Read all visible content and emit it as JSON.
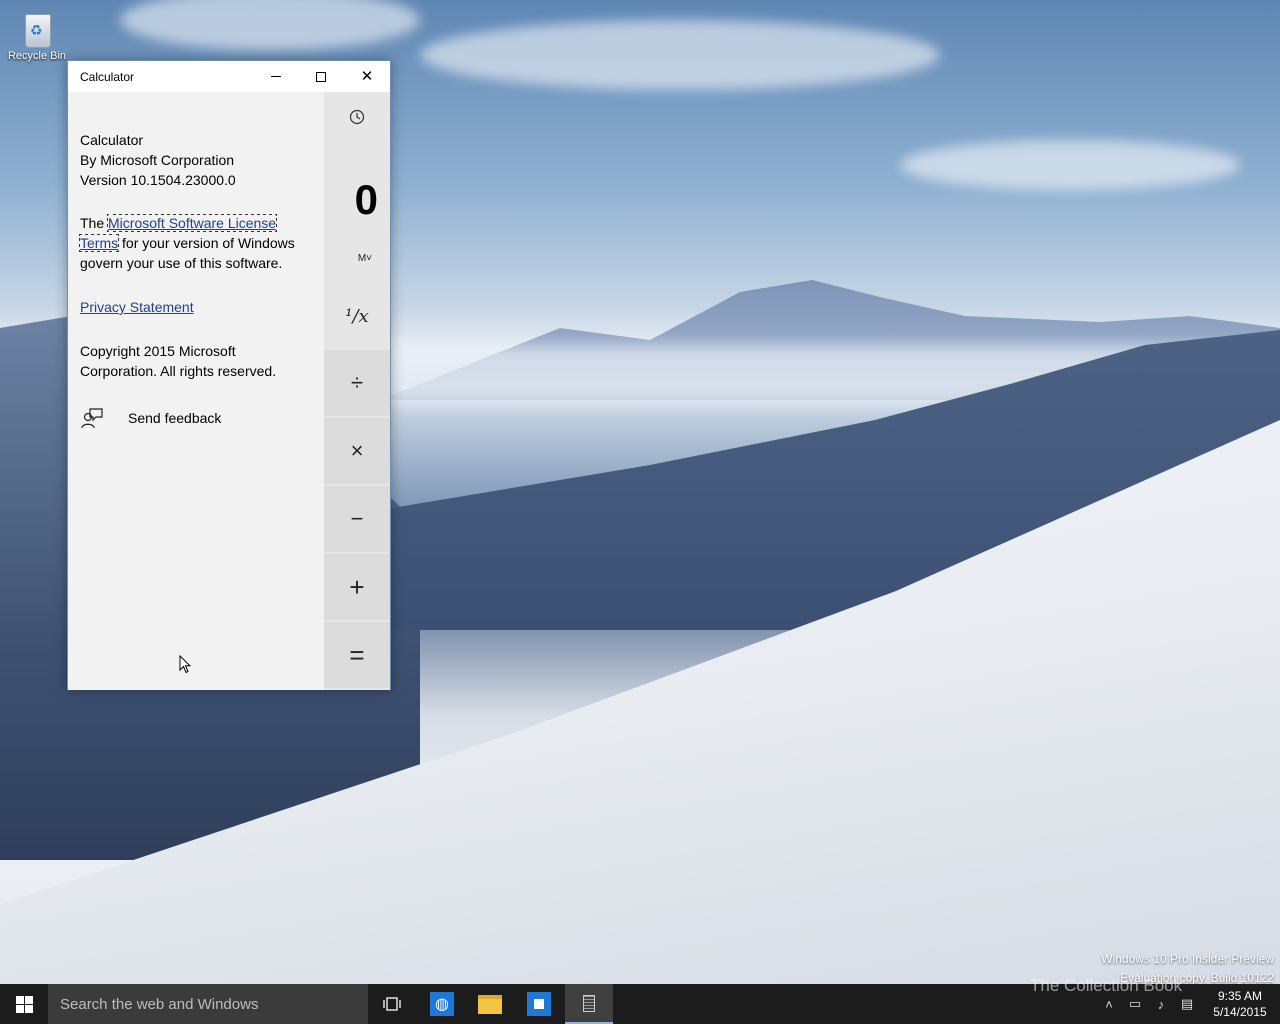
{
  "desktop": {
    "recycle_bin_label": "Recycle Bin",
    "watermark_line1": "Windows 10 Pro Insider Preview",
    "watermark_line2": "Evaluation copy. Build 10122",
    "book_watermark": "The Collection Book"
  },
  "window": {
    "title": "Calculator",
    "controls": {
      "minimize": "minimize",
      "maximize": "maximize",
      "close": "✕"
    }
  },
  "about": {
    "app_name": "Calculator",
    "publisher": "By Microsoft Corporation",
    "version": "Version 10.1504.23000.0",
    "license_prefix": "The ",
    "license_link": "Microsoft Software License Terms",
    "license_suffix": " for your version of Windows govern your use of this software.",
    "privacy_link": "Privacy Statement",
    "copyright": "Copyright 2015 Microsoft Corporation. All rights reserved.",
    "feedback_label": "Send feedback"
  },
  "calculator": {
    "display_value": "0",
    "memory_label": "M˅",
    "keys": {
      "reciprocal": "¹/x",
      "divide": "÷",
      "multiply": "×",
      "subtract": "−",
      "add": "+",
      "equals": "="
    }
  },
  "taskbar": {
    "search_placeholder": "Search the web and Windows",
    "clock_time": "9:35 AM",
    "clock_date": "5/14/2015",
    "accent_color": "#8ab4e8"
  }
}
